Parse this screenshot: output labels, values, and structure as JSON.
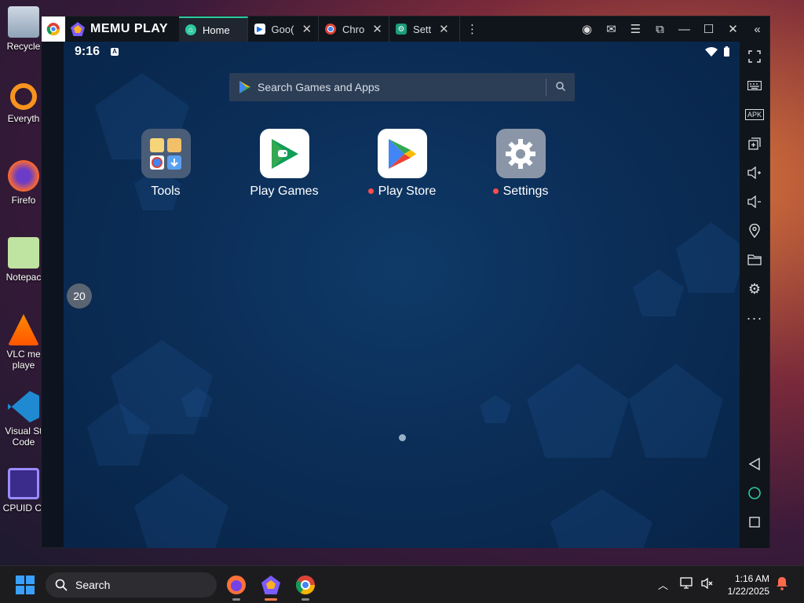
{
  "desktop": {
    "icons": [
      {
        "label": "Recycle",
        "icon": "recycle-bin-icon"
      },
      {
        "label": "Everyth",
        "icon": "everything-search-icon"
      },
      {
        "label": "Firefo",
        "icon": "firefox-icon"
      },
      {
        "label": "Notepac",
        "icon": "notepad-icon"
      },
      {
        "label": "VLC me",
        "label2": "playe",
        "icon": "vlc-icon"
      },
      {
        "label": "Visual St",
        "label2": "Code",
        "icon": "vscode-icon"
      },
      {
        "label": "CPUID CI",
        "icon": "cpuid-icon"
      }
    ]
  },
  "window": {
    "brand": "MEMU PLAY",
    "tabs": [
      {
        "label": "Home",
        "icon": "home-icon",
        "active": true
      },
      {
        "label": "Goo(",
        "icon": "google-play-icon"
      },
      {
        "label": "Chro",
        "icon": "chrome-icon"
      },
      {
        "label": "Sett",
        "icon": "settings-icon"
      }
    ],
    "titlebar_buttons": [
      "account-icon",
      "mail-icon",
      "menu-icon",
      "screen-mirror-icon",
      "minimize-icon",
      "maximize-icon",
      "close-icon",
      "collapse-sidebar-icon"
    ]
  },
  "android": {
    "time": "9:16",
    "search_placeholder": "Search Games and Apps",
    "apps": [
      {
        "label": "Tools",
        "icon": "tools-folder-icon",
        "badge": false
      },
      {
        "label": "Play Games",
        "icon": "play-games-icon",
        "badge": false
      },
      {
        "label": "Play Store",
        "icon": "play-store-icon",
        "badge": true
      },
      {
        "label": "Settings",
        "icon": "settings-gear-icon",
        "badge": true
      }
    ],
    "progress_label": "20"
  },
  "sidebar": {
    "buttons": [
      "fullscreen-icon",
      "keyboard-icon",
      "apk-icon",
      "multi-instance-icon",
      "volume-up-icon",
      "volume-down-icon",
      "location-icon",
      "folder-icon",
      "settings-icon",
      "more-icon",
      "back-icon",
      "home-icon",
      "recents-icon"
    ],
    "apk_label": "APK"
  },
  "taskbar": {
    "search_label": "Search",
    "time": "1:16 AM",
    "date": "1/22/2025"
  },
  "colors": {
    "accent": "#2fc9a0",
    "android_bg": "#0b2e58",
    "notification_dot": "#ff4d4d"
  }
}
